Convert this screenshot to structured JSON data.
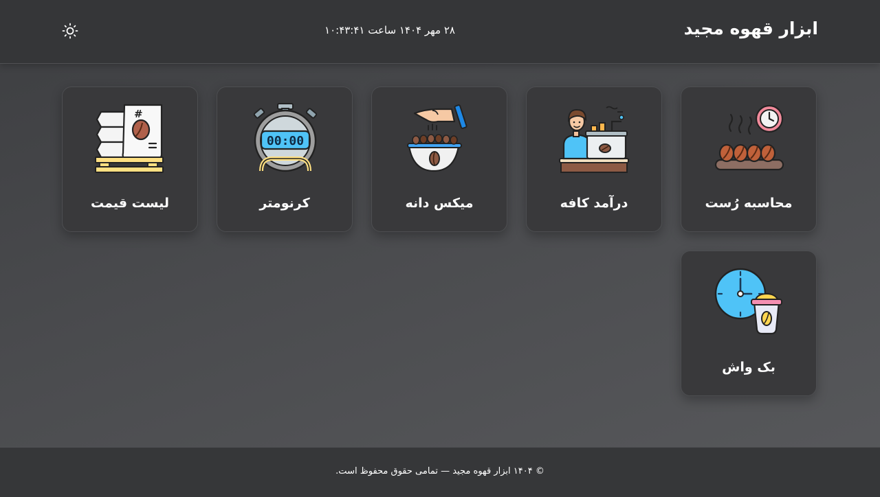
{
  "header": {
    "title": "ابزار قهوه مجید",
    "datetime": "۲۸ مهر ۱۴۰۴ ساعت ۱۰:۴۳:۴۱",
    "theme_toggle_icon": "sun-icon"
  },
  "tools": [
    {
      "label": "محاسبه رُست",
      "icon": "roasting-beans-timer-icon"
    },
    {
      "label": "درآمد کافه",
      "icon": "barista-espresso-machine-icon"
    },
    {
      "label": "میکس دانه",
      "icon": "hand-pouring-beans-icon"
    },
    {
      "label": "کرنومتر",
      "icon": "stopwatch-icon",
      "display": "00:00"
    },
    {
      "label": "لیست قیمت",
      "icon": "coffee-bags-price-list-icon",
      "tag": "#"
    },
    {
      "label": "بک واش",
      "icon": "clock-coffee-cup-icon"
    }
  ],
  "footer": {
    "copyright": "© ۱۴۰۴ ابزار قهوه مجید — تمامی حقوق محفوظ است."
  },
  "colors": {
    "header_bg": "#353638",
    "card_bg": "#39393b",
    "text": "#ffffff",
    "accent_blue": "#4fc3f7",
    "coffee_brown": "#a0522d",
    "accent_pink": "#f48fb1"
  }
}
